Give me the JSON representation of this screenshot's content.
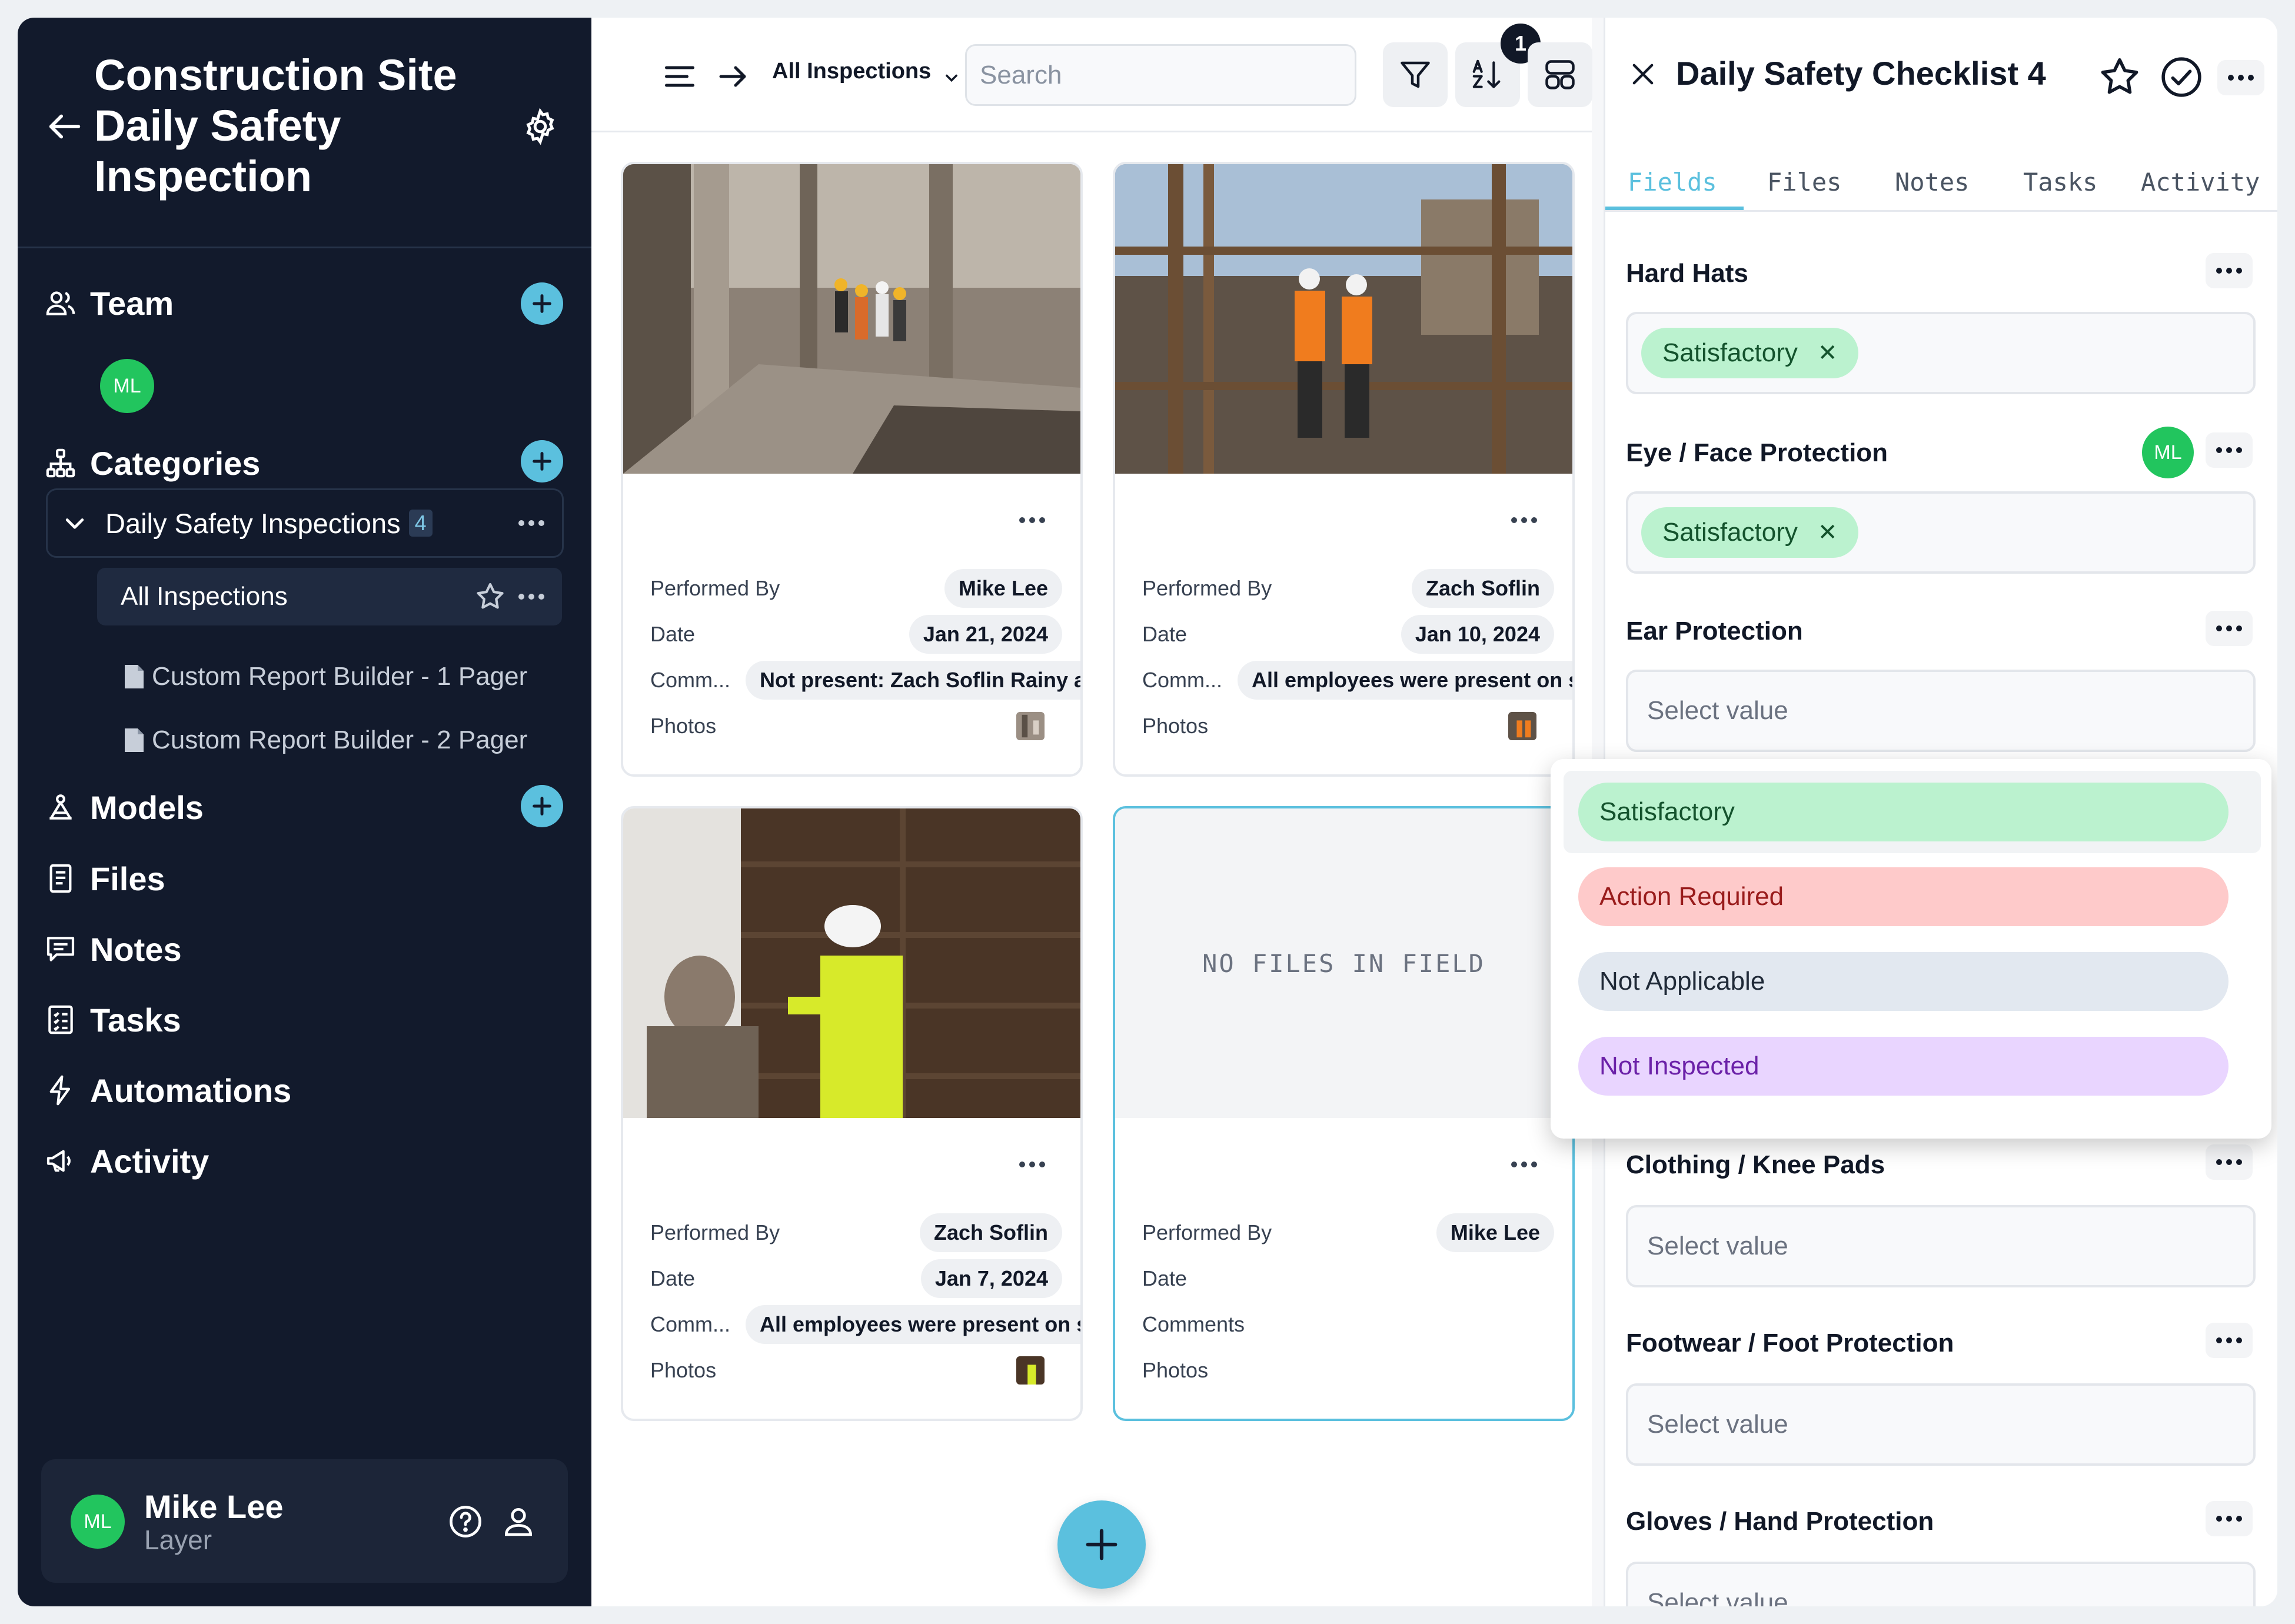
{
  "sidebar": {
    "title": "Construction Site Daily Safety Inspection",
    "sections": {
      "team": "Team",
      "categories": "Categories",
      "models": "Models",
      "files": "Files",
      "notes": "Notes",
      "tasks": "Tasks",
      "automations": "Automations",
      "activity": "Activity"
    },
    "team_avatar": "ML",
    "category": {
      "label": "Daily Safety Inspections",
      "count": "4"
    },
    "views": {
      "active": "All Inspections",
      "items": [
        "Custom Report Builder - 1 Pager",
        "Custom Report Builder - 2 Pager"
      ]
    },
    "user": {
      "initials": "ML",
      "name": "Mike Lee",
      "workspace": "Layer"
    }
  },
  "toolbar": {
    "view_name": "All Inspections",
    "search_placeholder": "Search",
    "sort_badge": "1"
  },
  "cards": [
    {
      "performed_by_label": "Performed By",
      "performed_by": "Mike Lee",
      "date_label": "Date",
      "date": "Jan 21, 2024",
      "comments_label": "Comm...",
      "comments": "Not present: Zach Soflin Rainy an",
      "photos_label": "Photos"
    },
    {
      "performed_by_label": "Performed By",
      "performed_by": "Zach Soflin",
      "date_label": "Date",
      "date": "Jan 10, 2024",
      "comments_label": "Comm...",
      "comments": "All employees were present on sit",
      "photos_label": "Photos"
    },
    {
      "performed_by_label": "Performed By",
      "performed_by": "Zach Soflin",
      "date_label": "Date",
      "date": "Jan 7, 2024",
      "comments_label": "Comm...",
      "comments": "All employees were present on sit",
      "photos_label": "Photos"
    },
    {
      "empty_text": "NO FILES IN FIELD",
      "performed_by_label": "Performed By",
      "performed_by": "Mike Lee",
      "date_label": "Date",
      "comments_label": "Comments",
      "photos_label": "Photos"
    }
  ],
  "panel": {
    "title": "Daily Safety Checklist 4",
    "tabs": [
      "Fields",
      "Files",
      "Notes",
      "Tasks",
      "Activity"
    ],
    "active_tab": "Fields",
    "editor_initials": "ML",
    "fields": [
      {
        "label": "Hard Hats",
        "value": "Satisfactory"
      },
      {
        "label": "Eye / Face Protection",
        "value": "Satisfactory"
      },
      {
        "label": "Ear Protection",
        "placeholder": "Select value"
      },
      {
        "label": "Clothing / Knee Pads",
        "placeholder": "Select value"
      },
      {
        "label": "Footwear / Foot Protection",
        "placeholder": "Select value"
      },
      {
        "label": "Gloves / Hand Protection",
        "placeholder": "Select value"
      }
    ],
    "options": [
      {
        "label": "Satisfactory",
        "bg": "#bbf2cf",
        "fg": "#14532d"
      },
      {
        "label": "Action Required",
        "bg": "#fecaca",
        "fg": "#991b1b"
      },
      {
        "label": "Not Applicable",
        "bg": "#e2e8f0",
        "fg": "#1f2937"
      },
      {
        "label": "Not Inspected",
        "bg": "#e9d5ff",
        "fg": "#6b21a8"
      }
    ]
  },
  "colors": {
    "accent": "#5bc0de",
    "sidebar_bg": "#121a2c",
    "avatar": "#22c55e"
  }
}
